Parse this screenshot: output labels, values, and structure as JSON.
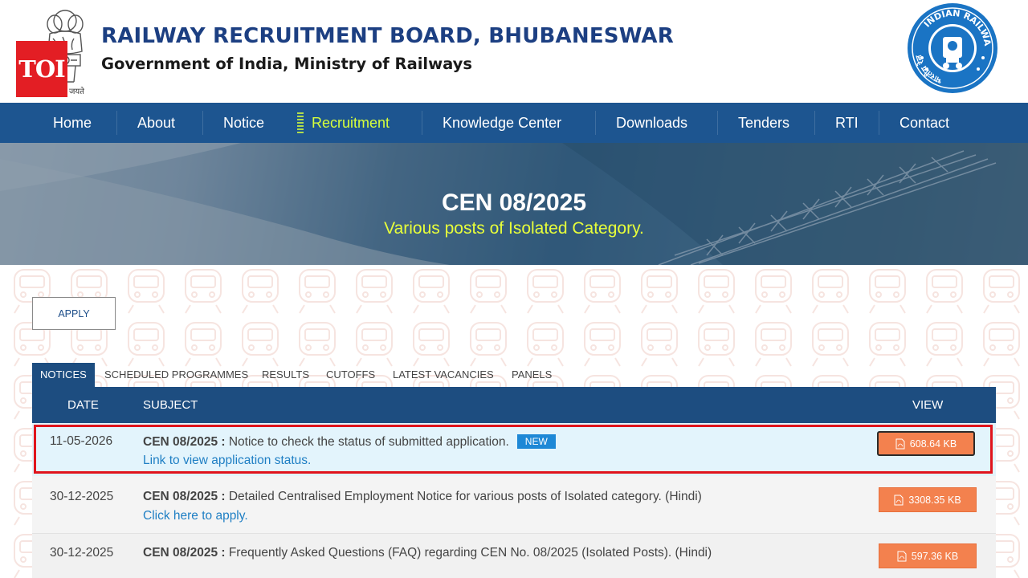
{
  "header": {
    "title": "RAILWAY RECRUITMENT BOARD, BHUBANESWAR",
    "subtitle": "Government of India, Ministry of Railways",
    "emblem_motto": "जयते",
    "toi_badge": "TOI",
    "logo_ring_text": "INDIAN RAILWAYS",
    "logo_ring_text_hindi": "भारतीय रेल"
  },
  "nav": {
    "items": [
      {
        "label": "Home"
      },
      {
        "label": "About"
      },
      {
        "label": "Notice"
      },
      {
        "label": "Recruitment",
        "active": true
      },
      {
        "label": "Knowledge Center"
      },
      {
        "label": "Downloads"
      },
      {
        "label": "Tenders"
      },
      {
        "label": "RTI"
      },
      {
        "label": "Contact"
      }
    ]
  },
  "banner": {
    "title": "CEN 08/2025",
    "subtitle": "Various posts of Isolated Category."
  },
  "apply_label": "APPLY",
  "tabs": [
    {
      "label": "NOTICES",
      "active": true
    },
    {
      "label": "SCHEDULED PROGRAMMES"
    },
    {
      "label": "RESULTS"
    },
    {
      "label": "CUTOFFS"
    },
    {
      "label": "LATEST VACANCIES"
    },
    {
      "label": "PANELS"
    }
  ],
  "table": {
    "headers": {
      "date": "DATE",
      "subject": "SUBJECT",
      "view": "VIEW"
    },
    "rows": [
      {
        "date": "11-05-2026",
        "code": "CEN 08/2025 :",
        "text": " Notice to check the status of submitted application.",
        "badge": "NEW",
        "link": "Link to view application status.",
        "file_size": "608.64 KB"
      },
      {
        "date": "30-12-2025",
        "code": "CEN 08/2025 :",
        "text": " Detailed Centralised Employment Notice for various posts of Isolated category. (Hindi)",
        "link": "Click here to apply.",
        "file_size": "3308.35 KB"
      },
      {
        "date": "30-12-2025",
        "code": "CEN 08/2025 :",
        "text": " Frequently Asked Questions (FAQ) regarding CEN No. 08/2025 (Isolated Posts). (Hindi)",
        "file_size": "597.36 KB"
      }
    ]
  },
  "colors": {
    "brand_blue": "#1c3f82",
    "nav_blue": "#1d5590",
    "table_header": "#1d4d80",
    "active_nav": "#d7ff3c",
    "pdf_orange": "#f3814e",
    "link_blue": "#1f7fc4",
    "highlight_red": "#e0141c"
  }
}
